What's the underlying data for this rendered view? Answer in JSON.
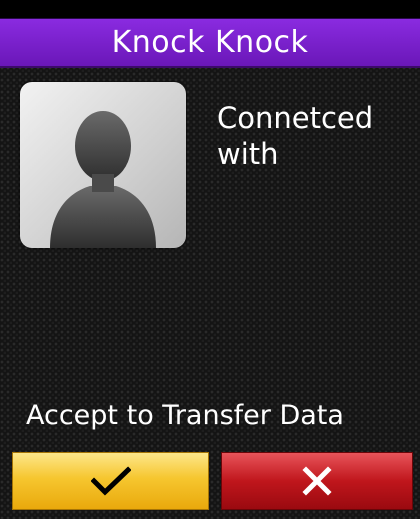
{
  "header": {
    "title": "Knock Knock"
  },
  "contact": {
    "avatar_icon": "person-silhouette-icon",
    "status_line1": "Connetced",
    "status_line2": "with"
  },
  "prompt": {
    "text": "Accept to Transfer Data"
  },
  "actions": {
    "accept_icon": "checkmark-icon",
    "decline_icon": "close-x-icon"
  },
  "colors": {
    "title_bar": "#7b22cc",
    "accept_button": "#f6c62f",
    "decline_button": "#c0161c"
  }
}
